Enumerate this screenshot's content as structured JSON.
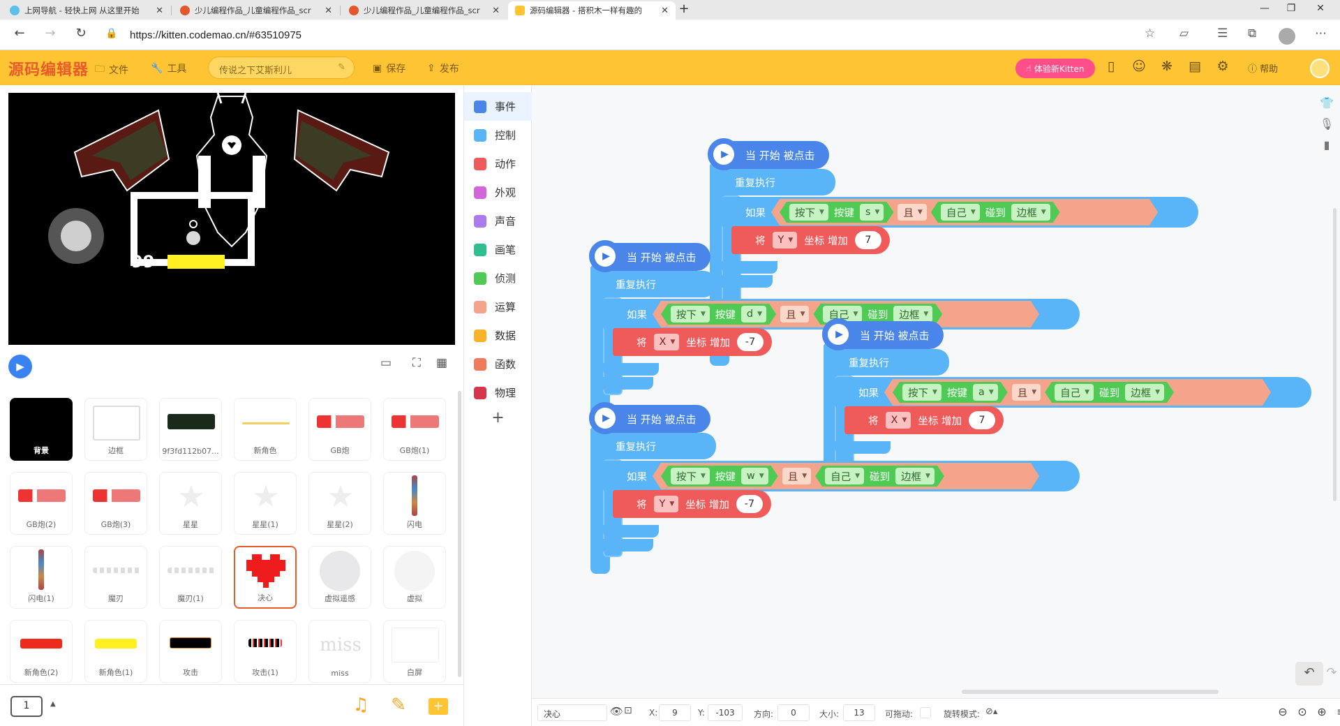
{
  "browser": {
    "tabs": [
      {
        "title": "上网导航 - 轻快上网 从这里开始",
        "active": false
      },
      {
        "title": "少儿编程作品_儿童编程作品_scr",
        "active": false
      },
      {
        "title": "少儿编程作品_儿童编程作品_scr",
        "active": false
      },
      {
        "title": "源码编辑器 - 搭积木一样有趣的",
        "active": true
      }
    ],
    "url": "https://kitten.codemao.cn/#63510975"
  },
  "header": {
    "logo": "源码编辑器",
    "file_label": "文件",
    "tools_label": "工具",
    "project_name": "传说之下艾斯利儿",
    "save_label": "保存",
    "publish_label": "发布",
    "try_new_label": "体验新Kitten",
    "help_label": "帮助"
  },
  "stage": {
    "score": "99"
  },
  "sprites": [
    {
      "name": "背景"
    },
    {
      "name": "边框"
    },
    {
      "name": "9f3fd112b07..."
    },
    {
      "name": "新角色"
    },
    {
      "name": "GB炮"
    },
    {
      "name": "GB炮(1)"
    },
    {
      "name": "GB炮(2)"
    },
    {
      "name": "GB炮(3)"
    },
    {
      "name": "星星"
    },
    {
      "name": "星星(1)"
    },
    {
      "name": "星星(2)"
    },
    {
      "name": "闪电"
    },
    {
      "name": "闪电(1)"
    },
    {
      "name": "魔刃"
    },
    {
      "name": "魔刃(1)"
    },
    {
      "name": "决心"
    },
    {
      "name": "虚拟遥感"
    },
    {
      "name": "虚拟"
    },
    {
      "name": "新角色(2)"
    },
    {
      "name": "新角色(1)"
    },
    {
      "name": "攻击"
    },
    {
      "name": "攻击(1)"
    },
    {
      "name": "miss"
    },
    {
      "name": "白屏"
    }
  ],
  "page_number": "1",
  "categories": [
    {
      "label": "事件",
      "color": "#4a86ea"
    },
    {
      "label": "控制",
      "color": "#5ab4f8"
    },
    {
      "label": "动作",
      "color": "#ef5b5b"
    },
    {
      "label": "外观",
      "color": "#d066d8"
    },
    {
      "label": "声音",
      "color": "#a97bee"
    },
    {
      "label": "画笔",
      "color": "#2fbf8f"
    },
    {
      "label": "侦测",
      "color": "#4fcb55"
    },
    {
      "label": "运算",
      "color": "#f3a48a"
    },
    {
      "label": "数据",
      "color": "#f7b32b"
    },
    {
      "label": "函数",
      "color": "#f07a5a"
    },
    {
      "label": "物理",
      "color": "#d6364b"
    }
  ],
  "blocks": {
    "when_start": "当 开始 被点击",
    "repeat": "重复执行",
    "if": "如果",
    "press": "按下",
    "key": "按键",
    "and": "且",
    "self": "自己",
    "touch": "碰到",
    "edge": "边框",
    "set": "将",
    "coord_add": "坐标 增加",
    "scripts": [
      {
        "key": "s",
        "axis": "Y",
        "value": "7"
      },
      {
        "key": "d",
        "axis": "X",
        "value": "-7"
      },
      {
        "key": "a",
        "axis": "X",
        "value": "7"
      },
      {
        "key": "w",
        "axis": "Y",
        "value": "-7"
      }
    ]
  },
  "status": {
    "sprite_name": "决心",
    "x_label": "X:",
    "x": "9",
    "y_label": "Y:",
    "y": "-103",
    "dir_label": "方向:",
    "dir": "0",
    "size_label": "大小:",
    "size": "13",
    "drag_label": "可拖动:",
    "rotate_label": "旋转模式:"
  }
}
